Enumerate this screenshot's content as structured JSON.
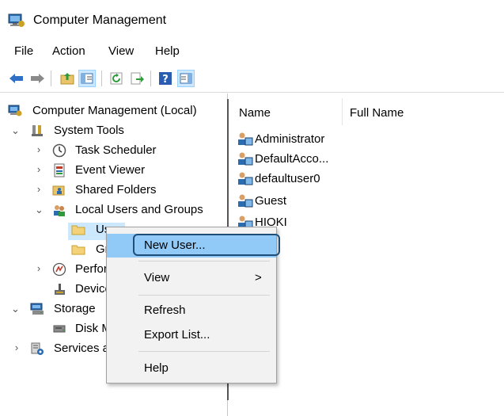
{
  "window": {
    "title": "Computer Management"
  },
  "menu": {
    "items": [
      "File",
      "Action",
      "View",
      "Help"
    ]
  },
  "toolbar": {
    "buttons": [
      "back-arrow-icon",
      "forward-arrow-icon",
      "up-folder-icon",
      "show-hide-tree-icon",
      "refresh-icon",
      "export-list-icon",
      "help-icon",
      "show-hide-action-pane-icon"
    ]
  },
  "tree": {
    "root": "Computer Management (Local)",
    "system_tools": "System Tools",
    "task_scheduler": "Task Scheduler",
    "event_viewer": "Event Viewer",
    "shared_folders": "Shared Folders",
    "local_users_groups": "Local Users and Groups",
    "users": "Users",
    "groups": "Groups",
    "performance": "Performance",
    "device_manager": "Device Manager",
    "storage": "Storage",
    "disk_management": "Disk Management",
    "services": "Services and Applications"
  },
  "list": {
    "columns": [
      "Name",
      "Full Name"
    ],
    "rows": [
      "Administrator",
      "DefaultAcco...",
      "defaultuser0",
      "Guest",
      "HIOKI"
    ]
  },
  "context_menu": {
    "new_user": "New User...",
    "view": "View",
    "view_arrow": ">",
    "refresh": "Refresh",
    "export_list": "Export List...",
    "help": "Help"
  },
  "colors": {
    "highlight": "#91c9f7",
    "callout_border": "#1f4e79",
    "selection": "#cce8ff"
  }
}
